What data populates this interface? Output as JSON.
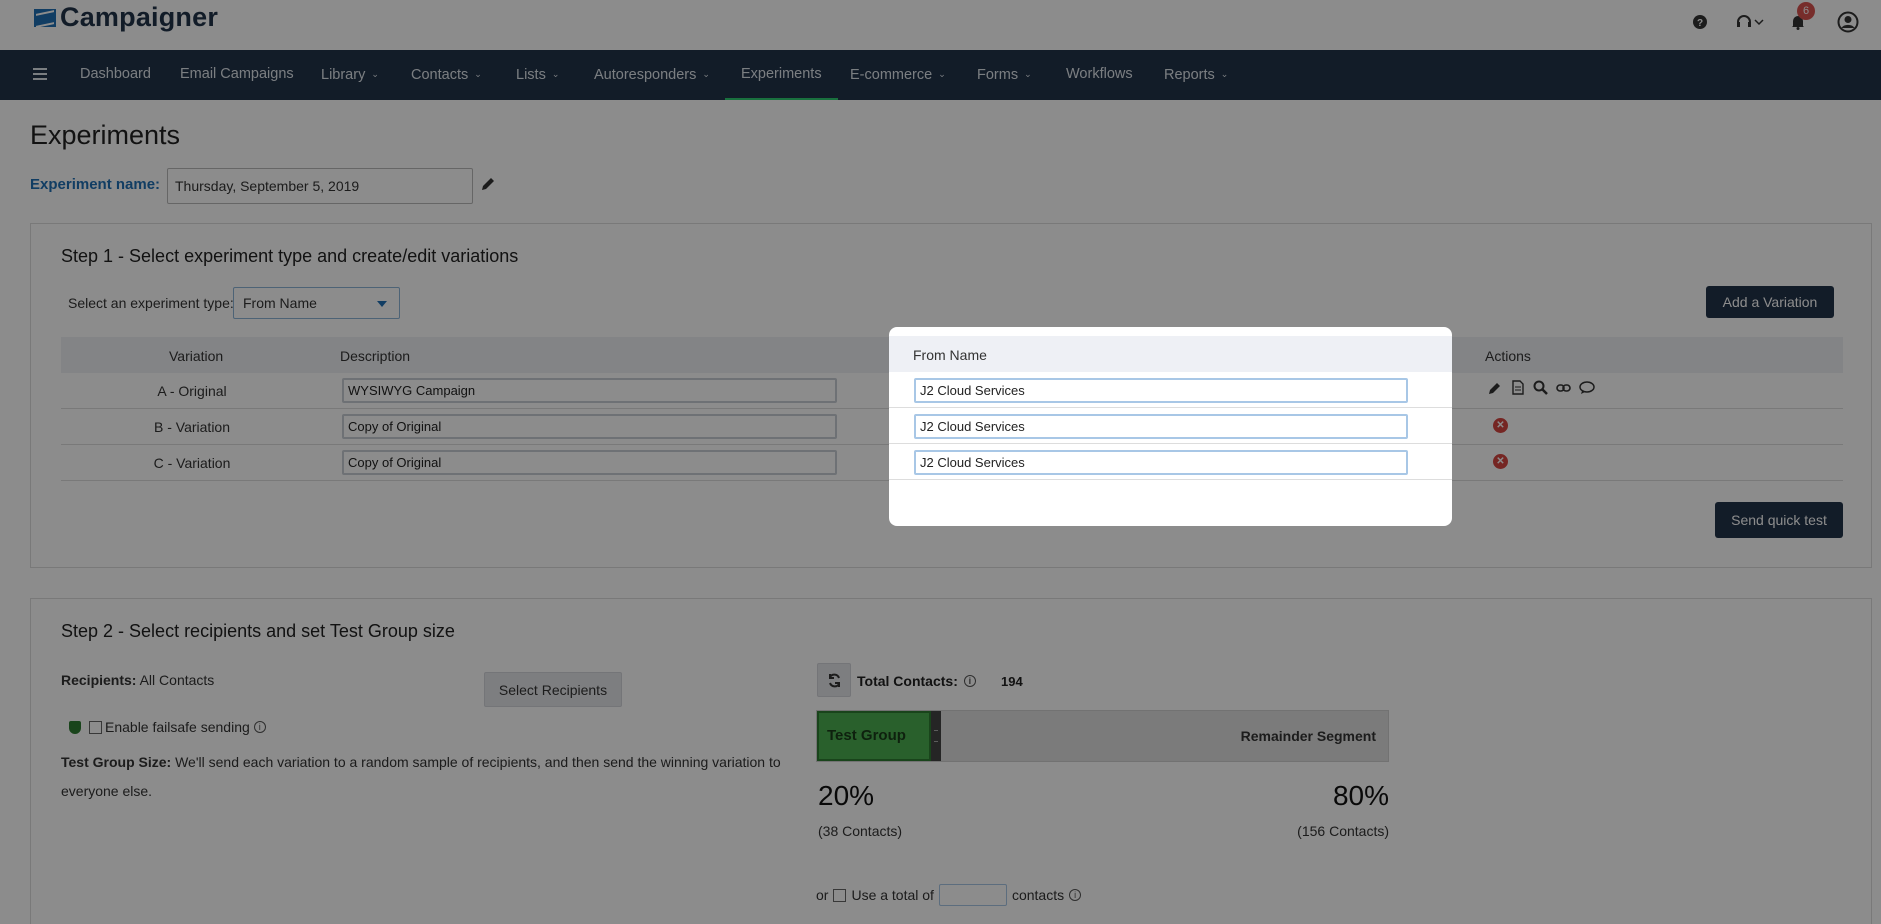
{
  "app": {
    "logo_text": "Campaigner",
    "notification_count": "6"
  },
  "nav": {
    "items": [
      {
        "label": "Dashboard",
        "dropdown": false
      },
      {
        "label": "Email Campaigns",
        "dropdown": false
      },
      {
        "label": "Library",
        "dropdown": true
      },
      {
        "label": "Contacts",
        "dropdown": true
      },
      {
        "label": "Lists",
        "dropdown": true
      },
      {
        "label": "Autoresponders",
        "dropdown": true
      },
      {
        "label": "Experiments",
        "dropdown": false,
        "active": true
      },
      {
        "label": "E-commerce",
        "dropdown": true
      },
      {
        "label": "Forms",
        "dropdown": true
      },
      {
        "label": "Workflows",
        "dropdown": false
      },
      {
        "label": "Reports",
        "dropdown": true
      }
    ]
  },
  "page": {
    "title": "Experiments",
    "experiment_name_label": "Experiment name:",
    "experiment_name_value": "Thursday, September 5, 2019"
  },
  "step1": {
    "title": "Step 1 - Select experiment type and create/edit variations",
    "type_label": "Select an experiment type:",
    "type_value": "From Name",
    "add_variation_label": "Add a Variation",
    "send_quick_test_label": "Send quick test",
    "columns": {
      "variation": "Variation",
      "description": "Description",
      "from_name": "From Name",
      "actions": "Actions"
    },
    "rows": [
      {
        "variation": "A - Original",
        "description": "WYSIWYG Campaign",
        "from_name": "J2 Cloud Services"
      },
      {
        "variation": "B - Variation",
        "description": "Copy of Original",
        "from_name": "J2 Cloud Services"
      },
      {
        "variation": "C - Variation",
        "description": "Copy of Original",
        "from_name": "J2 Cloud Services"
      }
    ]
  },
  "step2": {
    "title": "Step 2 - Select recipients and set Test Group size",
    "recipients_label": "Recipients:",
    "recipients_value": "All Contacts",
    "select_recipients_label": "Select Recipients",
    "failsafe_label": "Enable failsafe sending",
    "test_group_size_label": "Test Group Size:",
    "test_group_size_text": "We'll send each variation to a random sample of recipients, and then send the winning variation to everyone else.",
    "total_contacts_label": "Total Contacts:",
    "total_contacts_value": "194",
    "test_group_label": "Test Group",
    "remainder_label": "Remainder Segment",
    "test_group_pct": "20%",
    "remainder_pct": "80%",
    "test_group_fraction": 0.2,
    "test_group_count": "(38 Contacts)",
    "remainder_count": "(156 Contacts)",
    "or_label": "or",
    "use_total_label": "Use a total of",
    "contacts_label": "contacts"
  },
  "colors": {
    "nav_bg": "#22334a",
    "brand_blue": "#1f6fb5",
    "test_group_green": "#4caf50",
    "delete_red": "#d64541",
    "active_underline": "#2ecc71"
  }
}
